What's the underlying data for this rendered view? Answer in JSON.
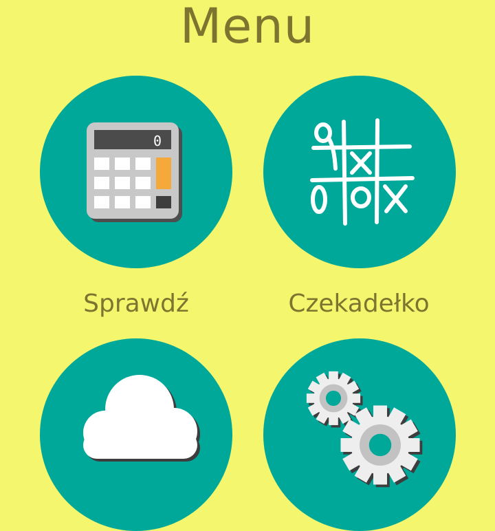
{
  "header": {
    "title": "Menu"
  },
  "menu": {
    "items": [
      {
        "label": "Sprawdź",
        "icon": "calculator-icon",
        "display": "0"
      },
      {
        "label": "Czekadełko",
        "icon": "tic-tac-toe-icon"
      },
      {
        "label": "",
        "icon": "cloud-icon"
      },
      {
        "label": "",
        "icon": "gears-icon"
      }
    ]
  },
  "colors": {
    "background": "#f4f76e",
    "tile": "#00a89a",
    "text": "#7c7530",
    "accent": "#f5a93a"
  }
}
